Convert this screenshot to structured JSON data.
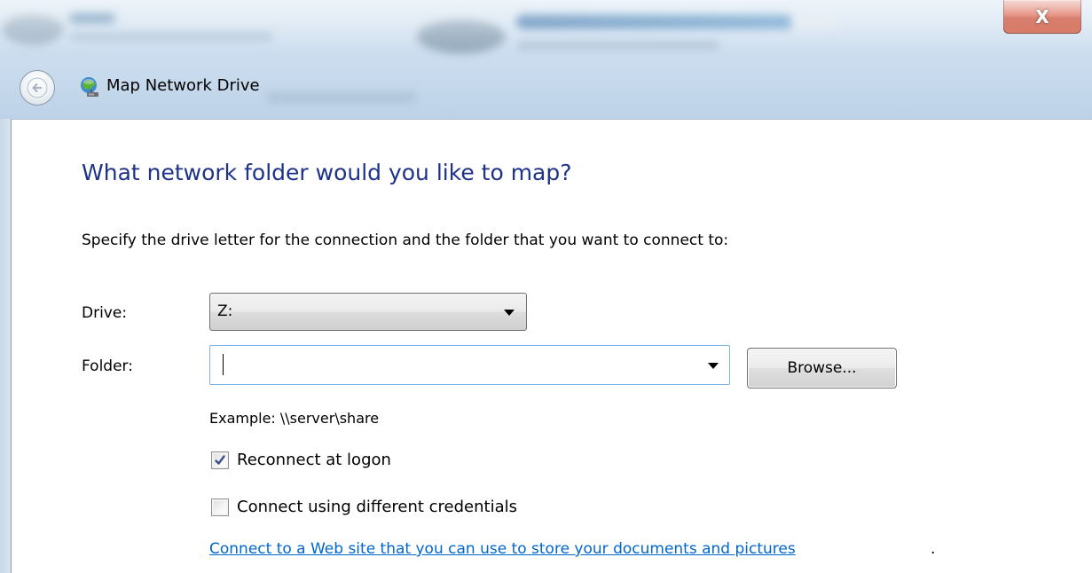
{
  "window": {
    "title": "Map Network Drive",
    "close_label": "X",
    "close_icon": "close-icon",
    "back_icon": "back-arrow-icon",
    "app_icon": "network-drive-icon"
  },
  "page": {
    "heading": "What network folder would you like to map?",
    "instruction": "Specify the drive letter for the connection and the folder that you want to connect to:"
  },
  "form": {
    "drive_label": "Drive:",
    "drive_value": "Z:",
    "folder_label": "Folder:",
    "folder_value": "",
    "browse_label": "Browse...",
    "example": "Example: \\\\server\\share",
    "reconnect": {
      "label": "Reconnect at logon",
      "checked": true
    },
    "credentials": {
      "label": "Connect using different credentials",
      "checked": false
    },
    "web_link": "Connect to a Web site that you can use to store your documents and pictures",
    "web_link_suffix": "."
  },
  "colors": {
    "heading": "#1e3287",
    "link": "#0066cc",
    "close_button": "#c3371f",
    "focus_border": "#7eb4ea"
  }
}
